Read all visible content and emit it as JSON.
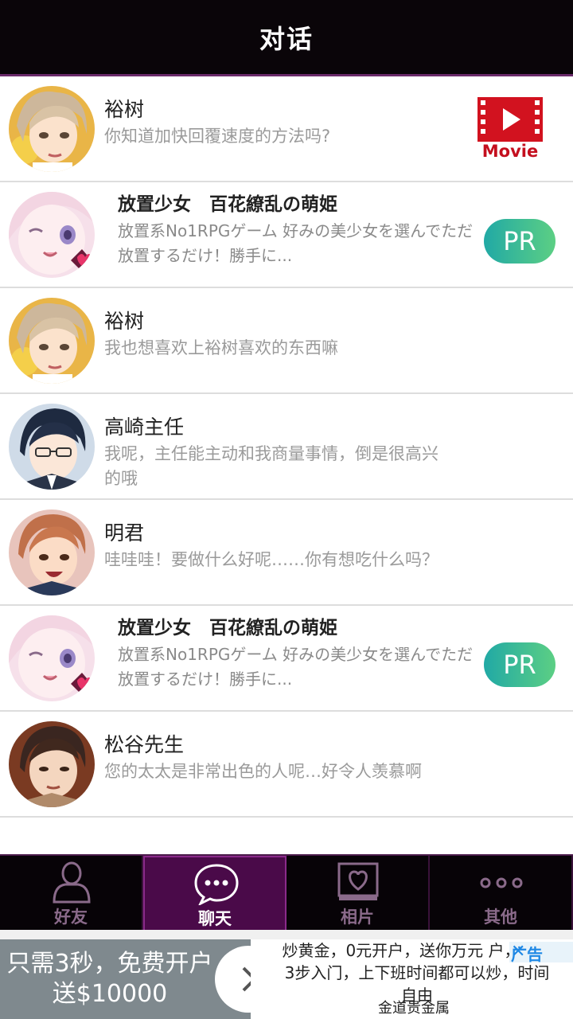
{
  "header": {
    "title": "对话"
  },
  "rows": [
    {
      "name": "裕树",
      "message": "你知道加快回覆速度的方法吗?",
      "avatar": "yuki-avatar",
      "action": "Movie"
    },
    {
      "name": "放置少女　百花繚乱の萌姫",
      "message": "放置系No1RPGゲーム 好みの美少女を選んでただ放置するだけ！勝手に...",
      "avatar": "moe-girl-avatar",
      "badge": "PR"
    },
    {
      "name": "裕树",
      "message": "我也想喜欢上裕树喜欢的东西嘛",
      "avatar": "yuki-avatar"
    },
    {
      "name": "高崎主任",
      "message": "我呢，主任能主动和我商量事情，倒是很高兴的哦",
      "avatar": "takasaki-avatar"
    },
    {
      "name": "明君",
      "message": "哇哇哇！要做什么好呢……你有想吃什么吗？",
      "avatar": "akira-avatar"
    },
    {
      "name": "放置少女　百花繚乱の萌姫",
      "message": "放置系No1RPGゲーム 好みの美少女を選んでただ放置するだけ！勝手に...",
      "avatar": "moe-girl-avatar",
      "badge": "PR"
    },
    {
      "name": "松谷先生",
      "message": "您的太太是非常出色的人呢…好令人羡慕啊",
      "avatar": "matsutani-avatar"
    }
  ],
  "tabs": [
    {
      "label": "好友",
      "icon": "person-icon",
      "active": false
    },
    {
      "label": "聊天",
      "icon": "chat-bubble-icon",
      "active": true
    },
    {
      "label": "相片",
      "icon": "heart-photo-icon",
      "active": false
    },
    {
      "label": "其他",
      "icon": "more-dots-icon",
      "active": false
    }
  ],
  "ad": {
    "left_text": "只需3秒，免费开户送$10000",
    "right_text": "炒黄金，0元开户，送你万元 户，新手3步入门，上下班时间都可以炒，时间自由",
    "source": "金道贵金属",
    "tag": "广告",
    "close": "✕"
  },
  "colors": {
    "header_bg": "#0a0509",
    "accent_purple": "#4a0a49",
    "pr_gradient_start": "#21a9a5",
    "pr_gradient_end": "#5ccf84",
    "movie_red": "#c40f1e"
  }
}
